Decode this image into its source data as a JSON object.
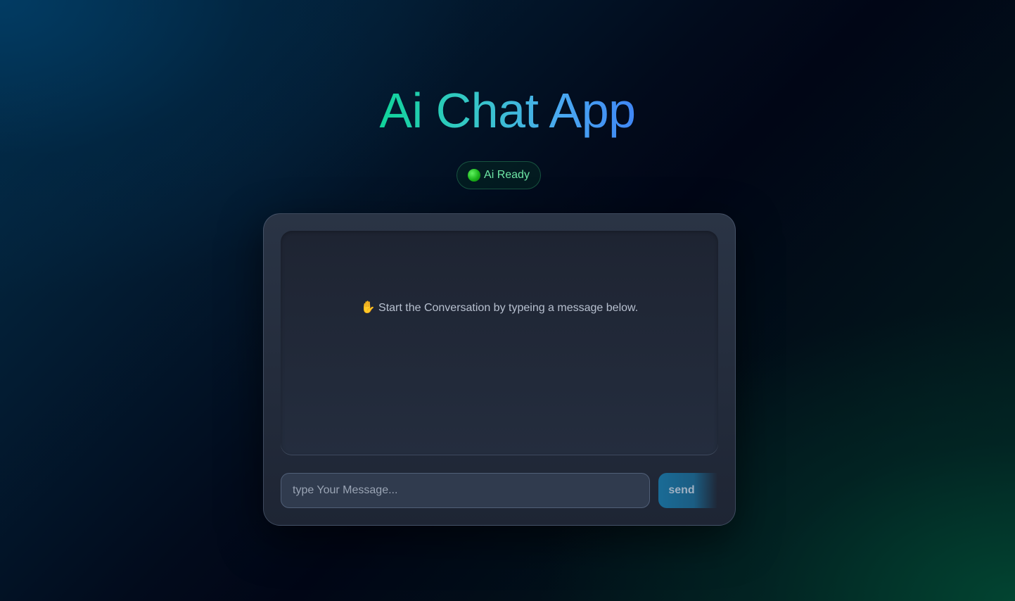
{
  "header": {
    "title": "Ai Chat App",
    "status": {
      "icon": "green-circle-icon",
      "label": "Ai Ready",
      "color": "#6ee7a6"
    }
  },
  "chat": {
    "empty_state": {
      "icon": "raised-hand-icon",
      "icon_glyph": "✋",
      "text": "Start the Conversation by typeing a message below."
    },
    "input": {
      "placeholder": "type Your Message...",
      "value": ""
    },
    "send_label": "send"
  },
  "colors": {
    "title_gradient_start": "#10d39a",
    "title_gradient_end": "#3f86f5",
    "send_button": "#1a6b96",
    "card_background": "#2a3445"
  }
}
